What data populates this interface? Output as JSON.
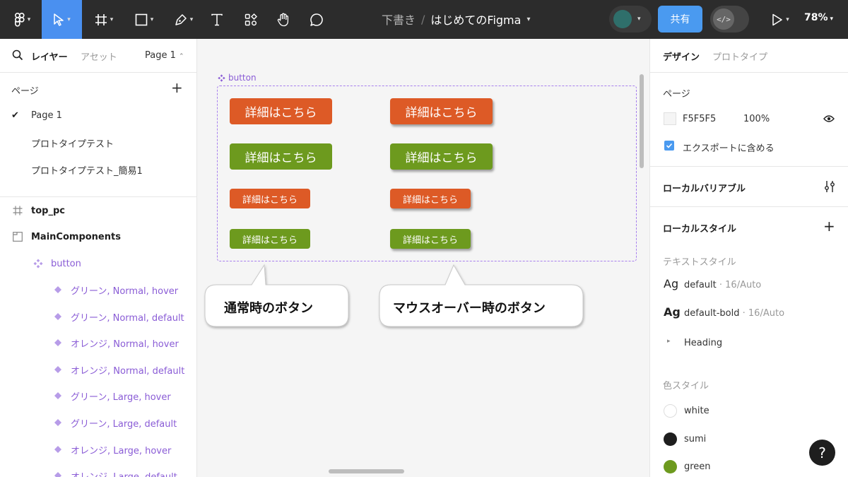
{
  "toolbar": {
    "file_folder": "下書き",
    "file_name": "はじめてのFigma",
    "share_label": "共有",
    "zoom": "78%",
    "accent": "#4a90f0"
  },
  "left_panel": {
    "tab_layers": "レイヤー",
    "tab_assets": "アセット",
    "page_selector": "Page 1",
    "pages_title": "ページ",
    "pages": [
      {
        "label": "Page 1",
        "current": true
      },
      {
        "label": "プロトタイプテスト"
      },
      {
        "label": "プロトタイプテスト_簡易1"
      }
    ],
    "layers": [
      {
        "label": "top_pc",
        "icon": "frame-icon"
      },
      {
        "label": "MainComponents",
        "icon": "section-icon"
      },
      {
        "label": "button",
        "icon": "component-set-icon"
      },
      {
        "label": "グリーン, Normal, hover",
        "icon": "variant-icon"
      },
      {
        "label": "グリーン, Normal, default",
        "icon": "variant-icon"
      },
      {
        "label": "オレンジ, Normal, hover",
        "icon": "variant-icon"
      },
      {
        "label": "オレンジ, Normal, default",
        "icon": "variant-icon"
      },
      {
        "label": "グリーン, Large, hover",
        "icon": "variant-icon"
      },
      {
        "label": "グリーン, Large, default",
        "icon": "variant-icon"
      },
      {
        "label": "オレンジ, Large, hover",
        "icon": "variant-icon"
      },
      {
        "label": "オレンジ, Large, default",
        "icon": "variant-icon"
      }
    ]
  },
  "canvas": {
    "frame_label": "button",
    "button_text": "詳細はこちら",
    "callout_normal": "通常時のボタン",
    "callout_hover": "マウスオーバー時のボタン",
    "colors": {
      "orange": "#dd5a26",
      "green": "#6d9a1e",
      "frame_border": "#a77fee"
    }
  },
  "right_panel": {
    "tab_design": "デザイン",
    "tab_prototype": "プロトタイプ",
    "page_section": "ページ",
    "page_bg_hex": "F5F5F5",
    "page_bg_opacity": "100%",
    "export_label": "エクスポートに含める",
    "local_variables": "ローカルバリアブル",
    "local_styles": "ローカルスタイル",
    "text_styles_title": "テキストスタイル",
    "ag": "Ag",
    "text_styles": [
      {
        "name": "default",
        "meta": " · 16/Auto"
      },
      {
        "name": "default-bold",
        "meta": " · 16/Auto"
      }
    ],
    "heading_group": "Heading",
    "color_styles_title": "色スタイル",
    "color_styles": [
      {
        "name": "white",
        "color": "#ffffff"
      },
      {
        "name": "sumi",
        "color": "#1e1e1e"
      },
      {
        "name": "green",
        "color": "#6d9a1e"
      }
    ]
  },
  "help_label": "?"
}
